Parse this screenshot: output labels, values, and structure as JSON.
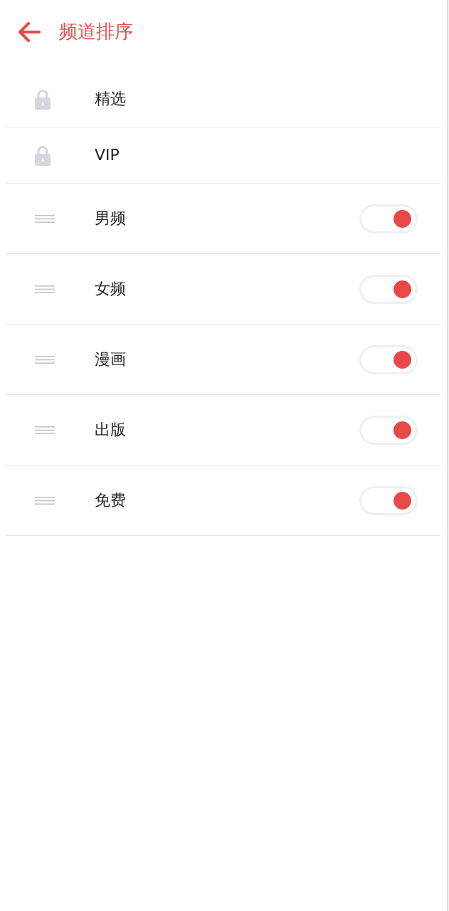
{
  "header": {
    "title": "频道排序"
  },
  "channels": [
    {
      "kind": "locked",
      "name": "精选"
    },
    {
      "kind": "locked",
      "name": "VIP"
    },
    {
      "kind": "toggle",
      "name": "男频",
      "on": true
    },
    {
      "kind": "toggle",
      "name": "女频",
      "on": true
    },
    {
      "kind": "toggle",
      "name": "漫画",
      "on": true
    },
    {
      "kind": "toggle",
      "name": "出版",
      "on": true
    },
    {
      "kind": "toggle",
      "name": "免费",
      "on": true
    }
  ]
}
